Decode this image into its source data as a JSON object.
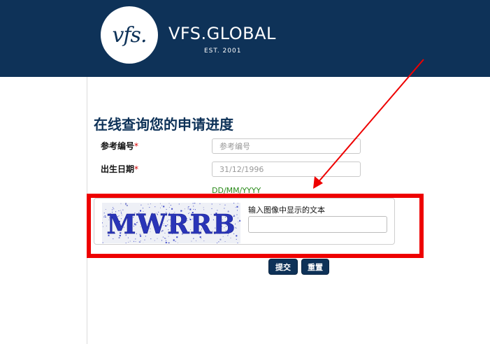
{
  "header": {
    "logo_mark": "vfs.",
    "brand_name": "VFS.GLOBAL",
    "brand_est": "EST. 2001",
    "color": "#0e3258"
  },
  "form": {
    "title": "在线查询您的申请进度",
    "reference": {
      "label": "参考编号",
      "required_mark": "*",
      "placeholder": "参考编号"
    },
    "dob": {
      "label": "出生日期",
      "required_mark": "*",
      "value": "31/12/1996",
      "hint": "DD/MM/YYYY"
    },
    "captcha": {
      "image_text": "MWRRB",
      "prompt": "输入图像中显示的文本",
      "value": ""
    },
    "submit_label": "提交",
    "reset_label": "重置"
  },
  "annotation": {
    "highlight_color": "#ee0000"
  }
}
